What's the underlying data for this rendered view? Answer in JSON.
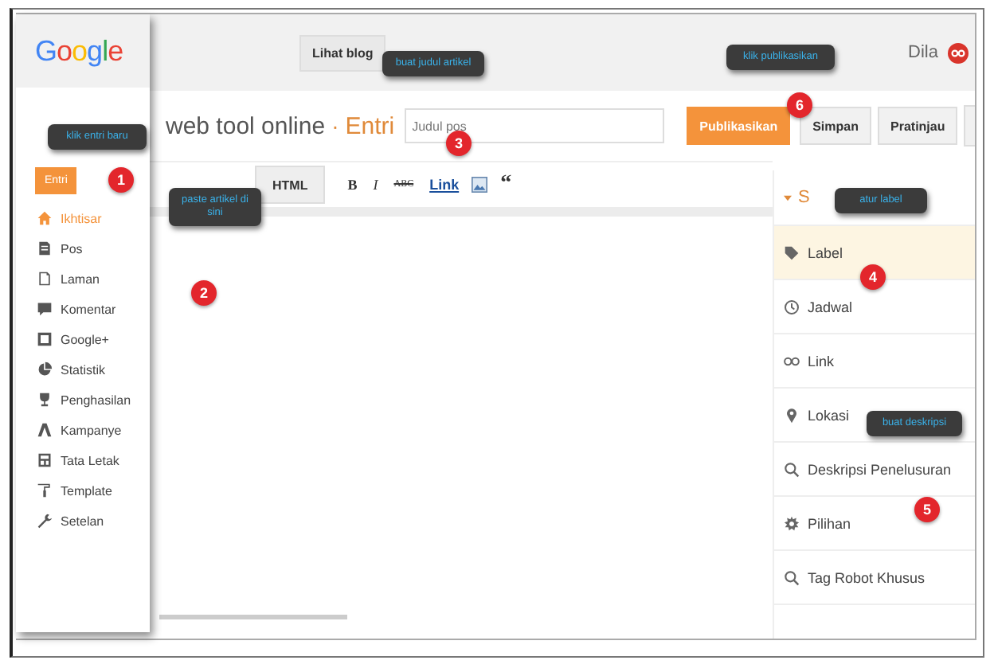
{
  "sidebar": {
    "logo": "Google",
    "new_post_button": "Entri",
    "items": [
      {
        "label": "Ikhtisar",
        "selected": true
      },
      {
        "label": "Pos",
        "selected": false
      },
      {
        "label": "Laman",
        "selected": false
      },
      {
        "label": "Komentar",
        "selected": false
      },
      {
        "label": "Google+",
        "selected": false
      },
      {
        "label": "Statistik",
        "selected": false
      },
      {
        "label": "Penghasilan",
        "selected": false
      },
      {
        "label": "Kampanye",
        "selected": false
      },
      {
        "label": "Tata Letak",
        "selected": false
      },
      {
        "label": "Template",
        "selected": false
      },
      {
        "label": "Setelan",
        "selected": false
      }
    ]
  },
  "topbar": {
    "view_blog_button": "Lihat blog",
    "user_name": "Dila"
  },
  "post_bar": {
    "blog_title": "web tool online",
    "separator": "·",
    "section": "Entri",
    "title_placeholder": "Judul pos",
    "buttons": [
      {
        "label": "Publikasikan",
        "kind": "primary"
      },
      {
        "label": "Simpan",
        "kind": "secondary"
      },
      {
        "label": "Pratinjau",
        "kind": "secondary"
      }
    ]
  },
  "editor": {
    "tabs": [
      {
        "label": "HTML",
        "selected": false
      }
    ],
    "format_buttons": [
      {
        "label": "B",
        "kind": "bold"
      },
      {
        "label": "I",
        "kind": "italic"
      },
      {
        "label": "ABC",
        "kind": "strike"
      },
      {
        "label": "Link",
        "kind": "link"
      },
      {
        "kind": "image"
      },
      {
        "label": "“",
        "kind": "quote"
      }
    ]
  },
  "settings": {
    "heading": "S",
    "items": [
      {
        "label": "Label",
        "selected": true
      },
      {
        "label": "Jadwal",
        "selected": false
      },
      {
        "label": "Link",
        "selected": false
      },
      {
        "label": "Lokasi",
        "selected": false
      },
      {
        "label": "Deskripsi Penelusuran",
        "selected": false
      },
      {
        "label": "Pilihan",
        "selected": false
      },
      {
        "label": "Tag Robot Khusus",
        "selected": false
      }
    ]
  },
  "callouts": [
    {
      "text": "klik entri baru",
      "step": "1"
    },
    {
      "text": "paste artikel di sini",
      "step": "2"
    },
    {
      "text": "buat judul artikel",
      "step": "3"
    },
    {
      "text": "atur label",
      "step": "4"
    },
    {
      "text": "buat deskripsi",
      "step": "5"
    },
    {
      "text": "klik publikasikan",
      "step": "6"
    }
  ]
}
